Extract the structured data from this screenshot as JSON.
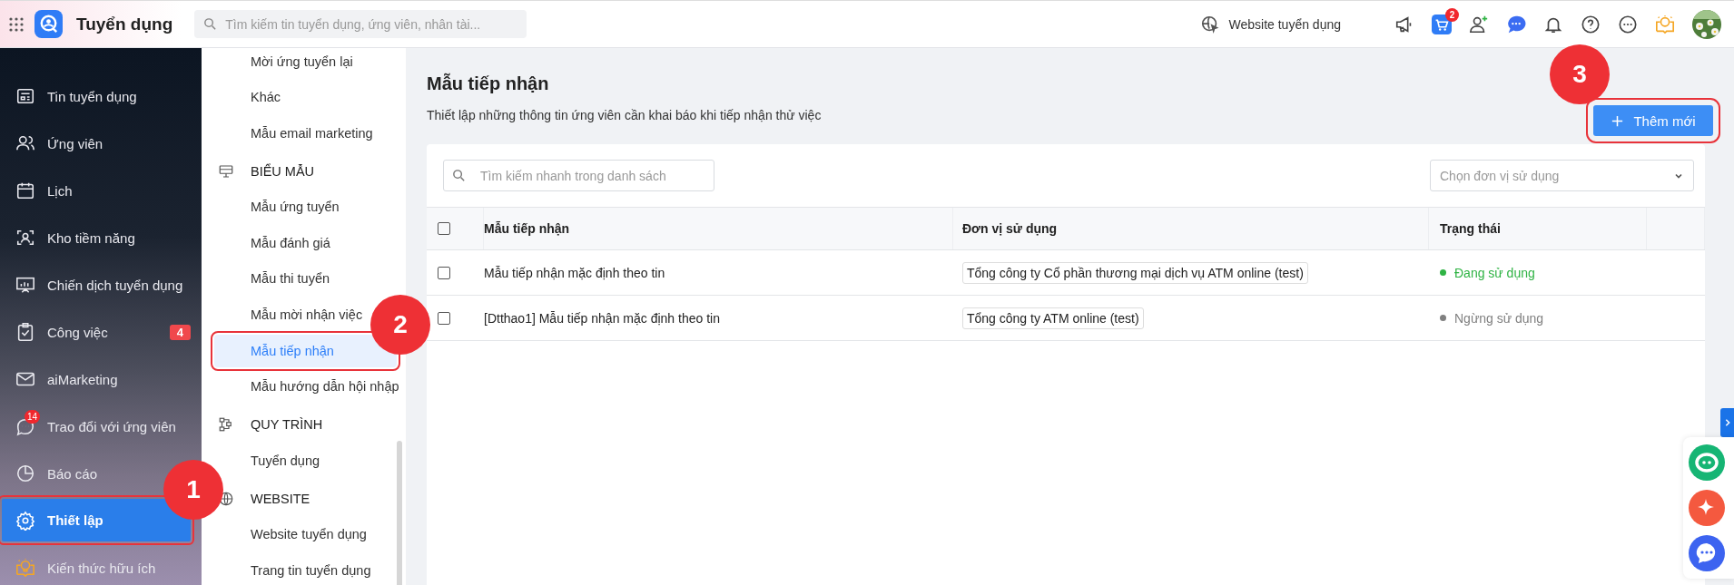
{
  "topbar": {
    "app_title": "Tuyển dụng",
    "search": {
      "placeholder": "Tìm kiếm tin tuyển dụng, ứng viên, nhân tài..."
    },
    "website_link": "Website tuyển dụng",
    "cart_badge": "2"
  },
  "sidebar": {
    "items": [
      {
        "label": "Tin tuyển dụng",
        "selected": false
      },
      {
        "label": "Ứng viên",
        "selected": false
      },
      {
        "label": "Lịch",
        "selected": false
      },
      {
        "label": "Kho tiềm năng",
        "selected": false
      },
      {
        "label": "Chiến dịch tuyển dụng",
        "selected": false
      },
      {
        "label": "Công việc",
        "selected": false,
        "badge": "4"
      },
      {
        "label": "aiMarketing",
        "selected": false
      },
      {
        "label": "Trao đổi với ứng viên",
        "selected": false,
        "icon_badge": "14"
      },
      {
        "label": "Báo cáo",
        "selected": false
      },
      {
        "label": "Thiết lập",
        "selected": true
      },
      {
        "label": "Kiến thức hữu ích",
        "selected": false
      }
    ]
  },
  "submenu": {
    "groups": [
      {
        "items": [
          {
            "label": "Mời ứng tuyển lại",
            "selected": false
          },
          {
            "label": "Khác",
            "selected": false
          },
          {
            "label": "Mẫu email marketing",
            "selected": false
          }
        ]
      },
      {
        "title": "BIỂU MẪU",
        "items": [
          {
            "label": "Mẫu ứng tuyển",
            "selected": false
          },
          {
            "label": "Mẫu đánh giá",
            "selected": false
          },
          {
            "label": "Mẫu thi tuyển",
            "selected": false
          },
          {
            "label": "Mẫu mời nhận việc",
            "selected": false
          },
          {
            "label": "Mẫu tiếp nhận",
            "selected": true
          },
          {
            "label": "Mẫu hướng dẫn hội nhập",
            "selected": false
          }
        ]
      },
      {
        "title": "QUY TRÌNH",
        "items": [
          {
            "label": "Tuyển dụng",
            "selected": false
          }
        ]
      },
      {
        "title": "WEBSITE",
        "items": [
          {
            "label": "Website tuyển dụng",
            "selected": false
          },
          {
            "label": "Trang tin tuyển dụng",
            "selected": false
          }
        ]
      }
    ]
  },
  "page": {
    "title": "Mẫu tiếp nhận",
    "subtitle": "Thiết lập những thông tin ứng viên cần khai báo khi tiếp nhận thử việc",
    "add_button": "Thêm mới"
  },
  "filters": {
    "search": {
      "placeholder": "Tìm kiếm nhanh trong danh sách"
    },
    "unit_select": {
      "placeholder": "Chọn đơn vị sử dụng"
    }
  },
  "table": {
    "all_checked": false,
    "columns": [
      "Mẫu tiếp nhận",
      "Đơn vị sử dụng",
      "Trạng thái"
    ],
    "rows": [
      {
        "checked": false,
        "name": "Mẫu tiếp nhận mặc định theo tin",
        "unit": "Tổng công ty Cổ phần thương mại dịch vụ ATM online (test)",
        "status": {
          "label": "Đang sử dụng",
          "color": "#2fb344"
        }
      },
      {
        "checked": false,
        "name": "[Dtthao1] Mẫu tiếp nhận mặc định theo tin",
        "unit": "Tổng công ty ATM online (test)",
        "status": {
          "label": "Ngừng sử dụng",
          "color": "#808080"
        }
      }
    ]
  },
  "callouts": [
    {
      "number": "1"
    },
    {
      "number": "2"
    },
    {
      "number": "3"
    }
  ]
}
